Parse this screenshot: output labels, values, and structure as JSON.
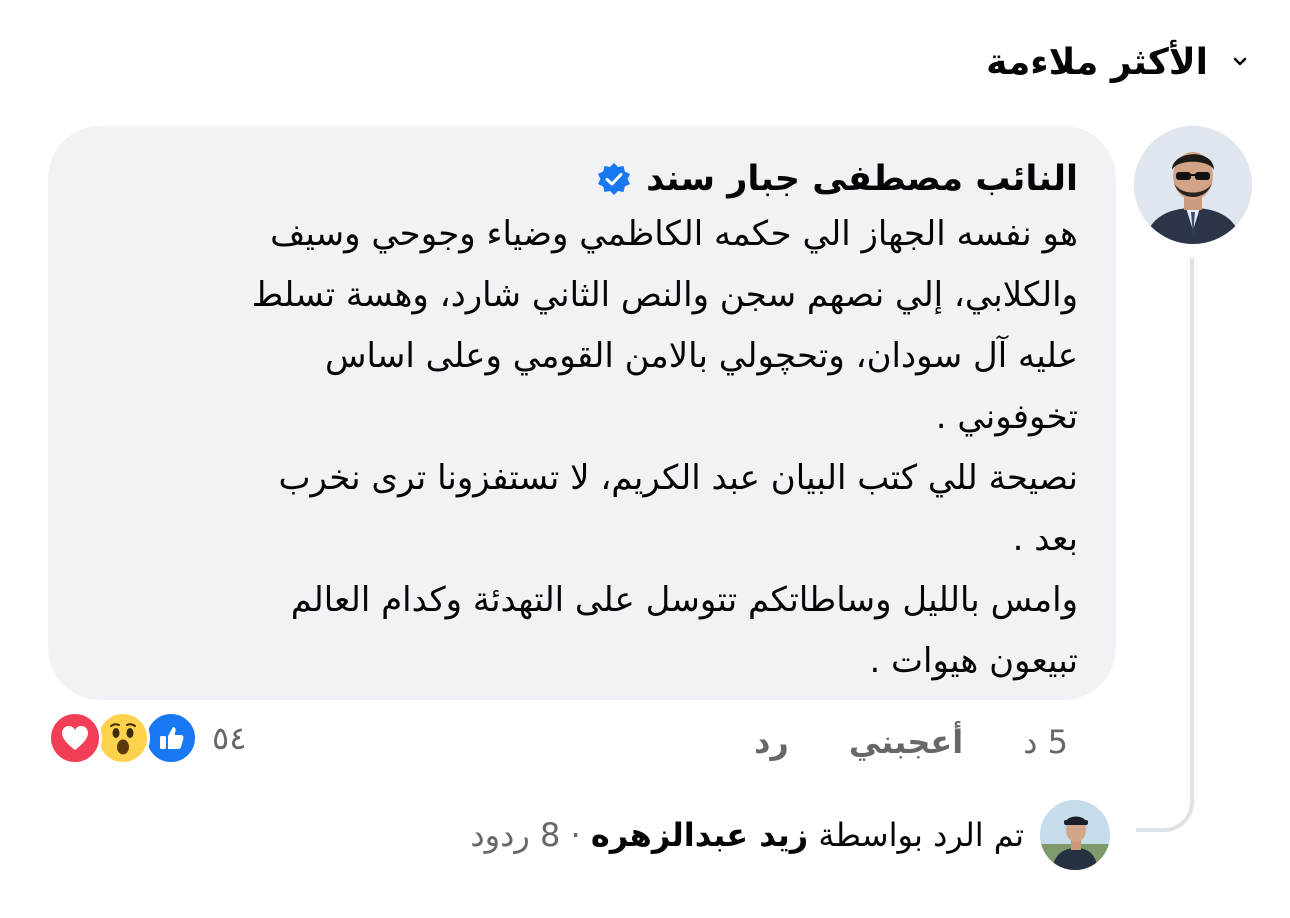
{
  "sort": {
    "label": "الأكثر ملاءمة",
    "icon": "chevron-down-icon"
  },
  "comment": {
    "author": "النائب  مصطفى  جبار سند",
    "verified_icon": "verified-badge-icon",
    "text": "هو نفسه الجهاز الي حكمه الكاظمي وضياء وجوحي وسيف\nوالكلابي، إلي نصهم سجن والنص الثاني شارد، وهسة تسلط\nعليه آل سودان، وتحچولي بالامن القومي وعلى اساس\nتخوفوني .\nنصيحة للي كتب البيان عبد الكريم، لا تستفزونا ترى نخرب\nبعد .\nوامس بالليل وساطاتكم تتوسل على التهدئة وكدام العالم\nتبيعون هيوات .",
    "time": "5 د",
    "like_label": "أعجبني",
    "reply_label": "رد",
    "reaction_count": "٥٤",
    "reactions": [
      "like-reaction-icon",
      "wow-reaction-icon",
      "love-reaction-icon"
    ],
    "colors": {
      "bubble": "#f0f2f5",
      "like": "#1877f2",
      "love": "#f33e58",
      "wow": "#ffd24d"
    }
  },
  "reply_summary": {
    "prefix": "تم الرد بواسطة",
    "by": "زيد عبدالزهره",
    "separator": "·",
    "count": "8 ردود"
  }
}
